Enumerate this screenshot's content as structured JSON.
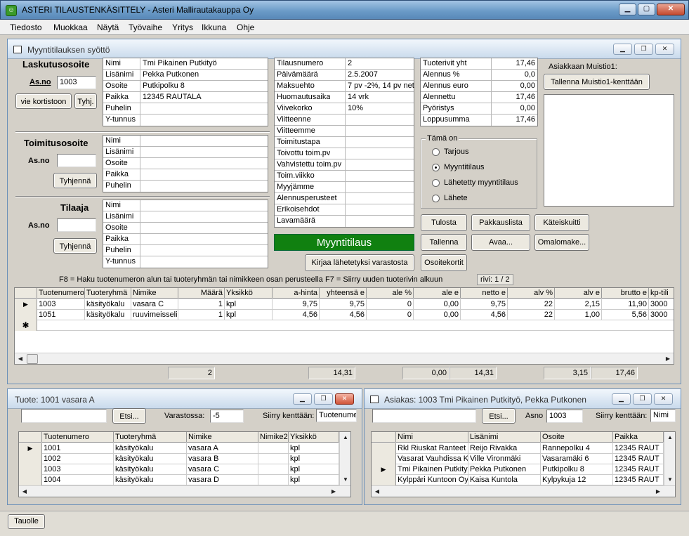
{
  "app": {
    "title": "ASTERI TILAUSTENKÄSITTELY - Asteri Mallirautakauppa Oy",
    "icon": "smiley-app-icon"
  },
  "menu": [
    "Tiedosto",
    "Muokkaa",
    "Näytä",
    "Työvaihe",
    "Yritys",
    "Ikkuna",
    "Ohje"
  ],
  "order_window": {
    "title": "Myyntitilauksen syöttö",
    "billing": {
      "header": "Laskutusosoite",
      "asno_label": "As.no",
      "asno_value": "1003",
      "btn_card": "vie kortistoon",
      "btn_clear": "Tyhj.",
      "fields": [
        {
          "label": "Nimi",
          "value": "Tmi Pikainen Putkityö"
        },
        {
          "label": "Lisänimi",
          "value": "Pekka Putkonen"
        },
        {
          "label": "Osoite",
          "value": "Putkipolku 8"
        },
        {
          "label": "Paikka",
          "value": "12345  RAUTALA"
        },
        {
          "label": "Puhelin",
          "value": ""
        },
        {
          "label": "Y-tunnus",
          "value": ""
        }
      ]
    },
    "delivery": {
      "header": "Toimitusosoite",
      "asno_label": "As.no",
      "asno_value": "",
      "btn_clear": "Tyhjennä",
      "fields": [
        {
          "label": "Nimi",
          "value": ""
        },
        {
          "label": "Lisänimi",
          "value": ""
        },
        {
          "label": "Osoite",
          "value": ""
        },
        {
          "label": "Paikka",
          "value": ""
        },
        {
          "label": "Puhelin",
          "value": ""
        }
      ]
    },
    "orderer": {
      "header": "Tilaaja",
      "asno_label": "As.no",
      "asno_value": "",
      "btn_clear": "Tyhjennä",
      "fields": [
        {
          "label": "Nimi",
          "value": ""
        },
        {
          "label": "Lisänimi",
          "value": ""
        },
        {
          "label": "Osoite",
          "value": ""
        },
        {
          "label": "Paikka",
          "value": ""
        },
        {
          "label": "Puhelin",
          "value": ""
        },
        {
          "label": "Y-tunnus",
          "value": ""
        }
      ]
    },
    "order_info": [
      {
        "label": "Tilausnumero",
        "value": "2"
      },
      {
        "label": "Päivämäärä",
        "value": "2.5.2007"
      },
      {
        "label": "Maksuehto",
        "value": "7 pv -2%, 14 pv net"
      },
      {
        "label": "Huomautusaika",
        "value": "14 vrk"
      },
      {
        "label": "Viivekorko",
        "value": "10%"
      },
      {
        "label": "Viitteenne",
        "value": ""
      },
      {
        "label": "Viitteemme",
        "value": ""
      },
      {
        "label": "Toimitustapa",
        "value": ""
      },
      {
        "label": "Toivottu toim.pv",
        "value": ""
      },
      {
        "label": "Vahvistettu toim.pv",
        "value": ""
      },
      {
        "label": "Toim.viikko",
        "value": ""
      },
      {
        "label": "Myyjämme",
        "value": ""
      },
      {
        "label": "Alennusperusteet",
        "value": ""
      },
      {
        "label": "Erikoisehdot",
        "value": ""
      },
      {
        "label": "Lavamäärä",
        "value": ""
      }
    ],
    "summary": [
      {
        "label": "Tuoterivit yht",
        "value": "17,46"
      },
      {
        "label": "Alennus %",
        "value": "0,0"
      },
      {
        "label": "Alennus euro",
        "value": "0,00"
      },
      {
        "label": "Alennettu",
        "value": "17,46"
      },
      {
        "label": "Pyöristys",
        "value": "0,00"
      },
      {
        "label": "Loppusumma",
        "value": "17,46"
      }
    ],
    "type_group": {
      "legend": "Tämä on",
      "options": [
        {
          "label": "Tarjous",
          "selected": false
        },
        {
          "label": "Myyntitilaus",
          "selected": true
        },
        {
          "label": "Lähetetty myyntitilaus",
          "selected": false
        },
        {
          "label": "Lähete",
          "selected": false
        }
      ]
    },
    "memo": {
      "label": "Asiakkaan Muistio1:",
      "save_btn": "Tallenna Muistio1-kenttään",
      "text": ""
    },
    "status_bar": "Myyntitilaus",
    "status_color": "#108010",
    "buttons": {
      "print": "Tulosta",
      "packing": "Pakkauslista",
      "cash_receipt": "Käteiskuitti",
      "save": "Tallenna",
      "open": "Avaa...",
      "own_form": "Omalomake...",
      "ship_stock": "Kirjaa lähetetyksi varastosta",
      "address_cards": "Osoitekortit"
    },
    "hints": {
      "f8": "F8 = Haku tuotenumeron alun tai tuoteryhmän tai nimikkeen osan perusteella",
      "f7": "F7 = Siirry uuden tuoterivin alkuun",
      "row": "rivi: 1 / 2"
    },
    "lines": {
      "columns": [
        "Tuotenumero",
        "Tuoteryhmä",
        "Nimike",
        "Määrä",
        "Yksikkö",
        "a-hinta",
        "yhteensä e",
        "ale %",
        "ale e",
        "netto e",
        "alv %",
        "alv e",
        "brutto e",
        "kp-tili"
      ],
      "rows": [
        [
          "1003",
          "käsityökalu",
          "vasara C",
          "1",
          "kpl",
          "9,75",
          "9,75",
          "0",
          "0,00",
          "9,75",
          "22",
          "2,15",
          "11,90",
          "3000"
        ],
        [
          "1051",
          "käsityökalu",
          "ruuvimeisseli",
          "1",
          "kpl",
          "4,56",
          "4,56",
          "0",
          "0,00",
          "4,56",
          "22",
          "1,00",
          "5,56",
          "3000"
        ]
      ],
      "totals": {
        "maara": "2",
        "yhteensa": "14,31",
        "ale_e": "0,00",
        "netto": "14,31",
        "alv_e": "3,15",
        "brutto": "17,46"
      }
    }
  },
  "product_window": {
    "title": "Tuote: 1001  vasara A",
    "search_value": "",
    "search_btn": "Etsi...",
    "stock_label": "Varastossa:",
    "stock_value": "-5",
    "goto_label": "Siirry kenttään:",
    "goto_value": "Tuotenume",
    "columns": [
      "Tuotenumero",
      "Tuoteryhmä",
      "Nimike",
      "Nimike2",
      "Yksikkö"
    ],
    "rows": [
      [
        "1001",
        "käsityökalu",
        "vasara A",
        "",
        "kpl"
      ],
      [
        "1002",
        "käsityökalu",
        "vasara B",
        "",
        "kpl"
      ],
      [
        "1003",
        "käsityökalu",
        "vasara C",
        "",
        "kpl"
      ],
      [
        "1004",
        "käsityökalu",
        "vasara D",
        "",
        "kpl"
      ]
    ]
  },
  "customer_window": {
    "title": "Asiakas: 1003  Tmi Pikainen Putkityö, Pekka Putkonen",
    "search_value": "",
    "search_btn": "Etsi...",
    "asno_label": "Asno",
    "asno_value": "1003",
    "goto_label": "Siirry kenttään:",
    "goto_value": "Nimi",
    "columns": [
      "Nimi",
      "Lisänimi",
      "Osoite",
      "Paikka"
    ],
    "rows": [
      [
        "Rkl Riuskat Ranteet",
        "Reijo Rivakka",
        "Rannepolku 4",
        "12345  RAUT"
      ],
      [
        "Vasarat Vauhdissa K",
        "Ville Vironmäki",
        "Vasaramäki 6",
        "12345  RAUT"
      ],
      [
        "Tmi Pikainen Putkityö",
        "Pekka Putkonen",
        "Putkipolku 8",
        "12345  RAUT"
      ],
      [
        "Kylppäri Kuntoon Oy",
        "Kaisa Kuntola",
        "Kylpykuja 12",
        "12345  RAUT"
      ]
    ]
  },
  "taskbar": {
    "restore_btn": "Tauolle"
  }
}
